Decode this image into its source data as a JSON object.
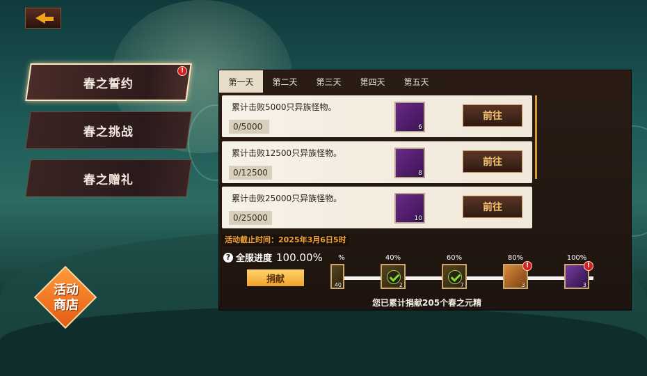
{
  "back_button": {
    "icon": "back-arrow-icon"
  },
  "sidebar": {
    "items": [
      {
        "label": "春之誓约",
        "active": true,
        "alert": "!"
      },
      {
        "label": "春之挑战",
        "active": false
      },
      {
        "label": "春之赠礼",
        "active": false
      }
    ]
  },
  "shop": {
    "line1": "活动",
    "line2": "商店"
  },
  "day_tabs": [
    "第一天",
    "第二天",
    "第三天",
    "第四天",
    "第五天"
  ],
  "tasks": [
    {
      "desc": "累计击败5000只异族怪物。",
      "progress": "0/5000",
      "reward_count": "6",
      "button": "前往",
      "reward_icon": "green-flame-icon"
    },
    {
      "desc": "累计击败12500只异族怪物。",
      "progress": "0/12500",
      "reward_count": "8",
      "button": "前往",
      "reward_icon": "green-flame-icon"
    },
    {
      "desc": "累计击败25000只异族怪物。",
      "progress": "0/25000",
      "reward_count": "10",
      "button": "前往",
      "reward_icon": "green-flame-icon"
    }
  ],
  "deadline": "活动截止时间：2025年3月6日5时",
  "server_progress": {
    "label": "全服进度",
    "value": "100.00%",
    "help_icon": "question-icon"
  },
  "donate_button": "捐献",
  "milestones": [
    {
      "pct": "%",
      "count": "40",
      "claimed": false
    },
    {
      "pct": "40%",
      "count": "2",
      "claimed": true
    },
    {
      "pct": "60%",
      "count": "7",
      "claimed": true
    },
    {
      "pct": "80%",
      "count": "3",
      "claimed": false,
      "alert": "!"
    },
    {
      "pct": "100%",
      "count": "3",
      "claimed": false,
      "alert": "!"
    }
  ],
  "donated_text": "您已累计捐献205个春之元精",
  "colors": {
    "accent": "#f1a21c",
    "alert": "#d42020",
    "deadline": "#f3a234"
  }
}
